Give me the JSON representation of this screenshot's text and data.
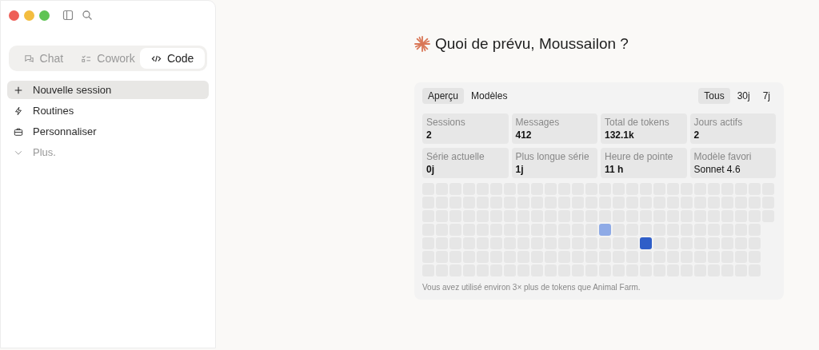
{
  "mode_tabs": [
    {
      "label": "Chat",
      "selected": false
    },
    {
      "label": "Cowork",
      "selected": false
    },
    {
      "label": "Code",
      "selected": true
    }
  ],
  "sidebar": {
    "items": [
      {
        "label": "Nouvelle session",
        "selected": true,
        "muted": false
      },
      {
        "label": "Routines",
        "selected": false,
        "muted": false
      },
      {
        "label": "Personnaliser",
        "selected": false,
        "muted": false
      },
      {
        "label": "Plus.",
        "selected": false,
        "muted": true
      }
    ]
  },
  "greeting": "Quoi de prévu, Moussailon ?",
  "stats": {
    "tabs": [
      {
        "label": "Aperçu",
        "selected": true
      },
      {
        "label": "Modèles",
        "selected": false
      }
    ],
    "ranges": [
      {
        "label": "Tous",
        "selected": true
      },
      {
        "label": "30j",
        "selected": false
      },
      {
        "label": "7j",
        "selected": false
      }
    ],
    "cards": [
      {
        "label": "Sessions",
        "value": "2",
        "bold": true
      },
      {
        "label": "Messages",
        "value": "412",
        "bold": true
      },
      {
        "label": "Total de tokens",
        "value": "132.1k",
        "bold": true
      },
      {
        "label": "Jours actifs",
        "value": "2",
        "bold": true
      },
      {
        "label": "Série actuelle",
        "value": "0j",
        "bold": true
      },
      {
        "label": "Plus longue série",
        "value": "1j",
        "bold": true
      },
      {
        "label": "Heure de pointe",
        "value": "11 h",
        "bold": true
      },
      {
        "label": "Modèle favori",
        "value": "Sonnet 4.6",
        "bold": false
      }
    ],
    "heatmap": [
      [
        {
          "color": "#e6e6e6"
        },
        {
          "color": "#e6e6e6"
        },
        {
          "color": "#e6e6e6"
        },
        {
          "color": "#e6e6e6"
        },
        {
          "color": "#e6e6e6"
        },
        {
          "color": "#e6e6e6"
        },
        {
          "color": "#e6e6e6"
        },
        {
          "color": "#e6e6e6"
        },
        {
          "color": "#e6e6e6"
        },
        {
          "color": "#e6e6e6"
        },
        {
          "color": "#e6e6e6"
        },
        {
          "color": "#e6e6e6"
        },
        {
          "color": "#e6e6e6"
        },
        {
          "color": "#e6e6e6"
        },
        {
          "color": "#e6e6e6"
        },
        {
          "color": "#e6e6e6"
        },
        {
          "color": "#e6e6e6"
        },
        {
          "color": "#e6e6e6"
        },
        {
          "color": "#e6e6e6"
        },
        {
          "color": "#e6e6e6"
        },
        {
          "color": "#e6e6e6"
        },
        {
          "color": "#e6e6e6"
        },
        {
          "color": "#e6e6e6"
        },
        {
          "color": "#e6e6e6"
        },
        {
          "color": "#e6e6e6"
        },
        {
          "color": "#e6e6e6"
        }
      ],
      [
        {
          "color": "#e6e6e6"
        },
        {
          "color": "#e6e6e6"
        },
        {
          "color": "#e6e6e6"
        },
        {
          "color": "#e6e6e6"
        },
        {
          "color": "#e6e6e6"
        },
        {
          "color": "#e6e6e6"
        },
        {
          "color": "#e6e6e6"
        },
        {
          "color": "#e6e6e6"
        },
        {
          "color": "#e6e6e6"
        },
        {
          "color": "#e6e6e6"
        },
        {
          "color": "#e6e6e6"
        },
        {
          "color": "#e6e6e6"
        },
        {
          "color": "#e6e6e6"
        },
        {
          "color": "#e6e6e6"
        },
        {
          "color": "#e6e6e6"
        },
        {
          "color": "#e6e6e6"
        },
        {
          "color": "#e6e6e6"
        },
        {
          "color": "#e6e6e6"
        },
        {
          "color": "#e6e6e6"
        },
        {
          "color": "#e6e6e6"
        },
        {
          "color": "#e6e6e6"
        },
        {
          "color": "#e6e6e6"
        },
        {
          "color": "#e6e6e6"
        },
        {
          "color": "#e6e6e6"
        },
        {
          "color": "#e6e6e6"
        },
        {
          "color": "#e6e6e6"
        }
      ],
      [
        {
          "color": "#e6e6e6"
        },
        {
          "color": "#e6e6e6"
        },
        {
          "color": "#e6e6e6"
        },
        {
          "color": "#e6e6e6"
        },
        {
          "color": "#e6e6e6"
        },
        {
          "color": "#e6e6e6"
        },
        {
          "color": "#e6e6e6"
        },
        {
          "color": "#e6e6e6"
        },
        {
          "color": "#e6e6e6"
        },
        {
          "color": "#e6e6e6"
        },
        {
          "color": "#e6e6e6"
        },
        {
          "color": "#e6e6e6"
        },
        {
          "color": "#e6e6e6"
        },
        {
          "color": "#e6e6e6"
        },
        {
          "color": "#e6e6e6"
        },
        {
          "color": "#e6e6e6"
        },
        {
          "color": "#e6e6e6"
        },
        {
          "color": "#e6e6e6"
        },
        {
          "color": "#e6e6e6"
        },
        {
          "color": "#e6e6e6"
        },
        {
          "color": "#e6e6e6"
        },
        {
          "color": "#e6e6e6"
        },
        {
          "color": "#e6e6e6"
        },
        {
          "color": "#e6e6e6"
        },
        {
          "color": "#e6e6e6"
        },
        {
          "color": "#e6e6e6"
        }
      ],
      [
        {
          "color": "#e6e6e6"
        },
        {
          "color": "#e6e6e6"
        },
        {
          "color": "#e6e6e6"
        },
        {
          "color": "#e6e6e6"
        },
        {
          "color": "#e6e6e6"
        },
        {
          "color": "#e6e6e6"
        },
        {
          "color": "#e6e6e6"
        },
        {
          "color": "#e6e6e6"
        },
        {
          "color": "#e6e6e6"
        },
        {
          "color": "#e6e6e6"
        },
        {
          "color": "#e6e6e6"
        },
        {
          "color": "#e6e6e6"
        },
        {
          "color": "#e6e6e6"
        },
        {
          "color": "#8eaae6"
        },
        {
          "color": "#e6e6e6"
        },
        {
          "color": "#e6e6e6"
        },
        {
          "color": "#e6e6e6"
        },
        {
          "color": "#e6e6e6"
        },
        {
          "color": "#e6e6e6"
        },
        {
          "color": "#e6e6e6"
        },
        {
          "color": "#e6e6e6"
        },
        {
          "color": "#e6e6e6"
        },
        {
          "color": "#e6e6e6"
        },
        {
          "color": "#e6e6e6"
        },
        {
          "color": "#e6e6e6"
        }
      ],
      [
        {
          "color": "#e6e6e6"
        },
        {
          "color": "#e6e6e6"
        },
        {
          "color": "#e6e6e6"
        },
        {
          "color": "#e6e6e6"
        },
        {
          "color": "#e6e6e6"
        },
        {
          "color": "#e6e6e6"
        },
        {
          "color": "#e6e6e6"
        },
        {
          "color": "#e6e6e6"
        },
        {
          "color": "#e6e6e6"
        },
        {
          "color": "#e6e6e6"
        },
        {
          "color": "#e6e6e6"
        },
        {
          "color": "#e6e6e6"
        },
        {
          "color": "#e6e6e6"
        },
        {
          "color": "#e6e6e6"
        },
        {
          "color": "#e6e6e6"
        },
        {
          "color": "#e6e6e6"
        },
        {
          "color": "#2f5ec8"
        },
        {
          "color": "#e6e6e6"
        },
        {
          "color": "#e6e6e6"
        },
        {
          "color": "#e6e6e6"
        },
        {
          "color": "#e6e6e6"
        },
        {
          "color": "#e6e6e6"
        },
        {
          "color": "#e6e6e6"
        },
        {
          "color": "#e6e6e6"
        },
        {
          "color": "#e6e6e6"
        }
      ],
      [
        {
          "color": "#e6e6e6"
        },
        {
          "color": "#e6e6e6"
        },
        {
          "color": "#e6e6e6"
        },
        {
          "color": "#e6e6e6"
        },
        {
          "color": "#e6e6e6"
        },
        {
          "color": "#e6e6e6"
        },
        {
          "color": "#e6e6e6"
        },
        {
          "color": "#e6e6e6"
        },
        {
          "color": "#e6e6e6"
        },
        {
          "color": "#e6e6e6"
        },
        {
          "color": "#e6e6e6"
        },
        {
          "color": "#e6e6e6"
        },
        {
          "color": "#e6e6e6"
        },
        {
          "color": "#e6e6e6"
        },
        {
          "color": "#e6e6e6"
        },
        {
          "color": "#e6e6e6"
        },
        {
          "color": "#e6e6e6"
        },
        {
          "color": "#e6e6e6"
        },
        {
          "color": "#e6e6e6"
        },
        {
          "color": "#e6e6e6"
        },
        {
          "color": "#e6e6e6"
        },
        {
          "color": "#e6e6e6"
        },
        {
          "color": "#e6e6e6"
        },
        {
          "color": "#e6e6e6"
        },
        {
          "color": "#e6e6e6"
        }
      ],
      [
        {
          "color": "#e6e6e6"
        },
        {
          "color": "#e6e6e6"
        },
        {
          "color": "#e6e6e6"
        },
        {
          "color": "#e6e6e6"
        },
        {
          "color": "#e6e6e6"
        },
        {
          "color": "#e6e6e6"
        },
        {
          "color": "#e6e6e6"
        },
        {
          "color": "#e6e6e6"
        },
        {
          "color": "#e6e6e6"
        },
        {
          "color": "#e6e6e6"
        },
        {
          "color": "#e6e6e6"
        },
        {
          "color": "#e6e6e6"
        },
        {
          "color": "#e6e6e6"
        },
        {
          "color": "#e6e6e6"
        },
        {
          "color": "#e6e6e6"
        },
        {
          "color": "#e6e6e6"
        },
        {
          "color": "#e6e6e6"
        },
        {
          "color": "#e6e6e6"
        },
        {
          "color": "#e6e6e6"
        },
        {
          "color": "#e6e6e6"
        },
        {
          "color": "#e6e6e6"
        },
        {
          "color": "#e6e6e6"
        },
        {
          "color": "#e6e6e6"
        },
        {
          "color": "#e6e6e6"
        },
        {
          "color": "#e6e6e6"
        }
      ]
    ],
    "footnote": "Vous avez utilisé environ 3× plus de tokens que Animal Farm."
  }
}
